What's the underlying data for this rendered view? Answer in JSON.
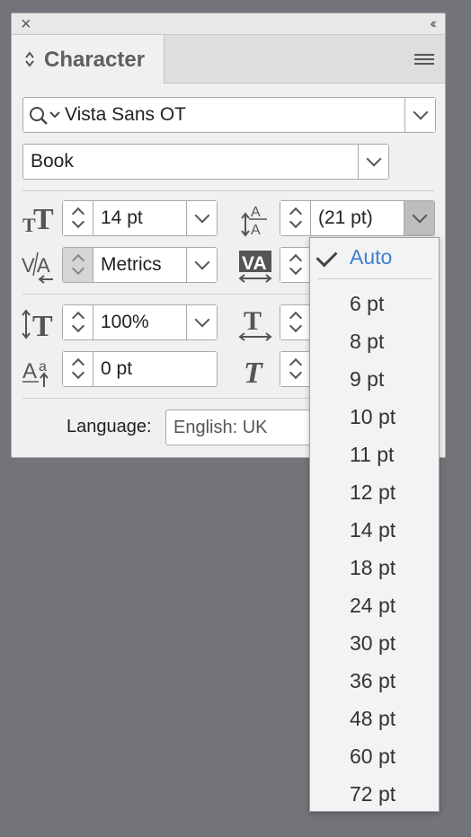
{
  "panel": {
    "tab_label": "Character",
    "close_glyph": "×",
    "collapse_glyph": "‹‹"
  },
  "font": {
    "family": "Vista Sans OT",
    "style": "Book"
  },
  "fields": {
    "font_size": "14 pt",
    "leading": "(21 pt)",
    "kerning": "Metrics",
    "vertical_scale": "100%",
    "baseline_shift": "0 pt"
  },
  "language": {
    "label": "Language:",
    "value": "English: UK"
  },
  "leading_menu": {
    "selected": "Auto",
    "options": [
      "6 pt",
      "8 pt",
      "9 pt",
      "10 pt",
      "11 pt",
      "12 pt",
      "14 pt",
      "18 pt",
      "24 pt",
      "30 pt",
      "36 pt",
      "48 pt",
      "60 pt",
      "72 pt"
    ]
  },
  "colors": {
    "accent": "#3b7fd4",
    "background": "#737479",
    "panel": "#f0f0f0"
  }
}
